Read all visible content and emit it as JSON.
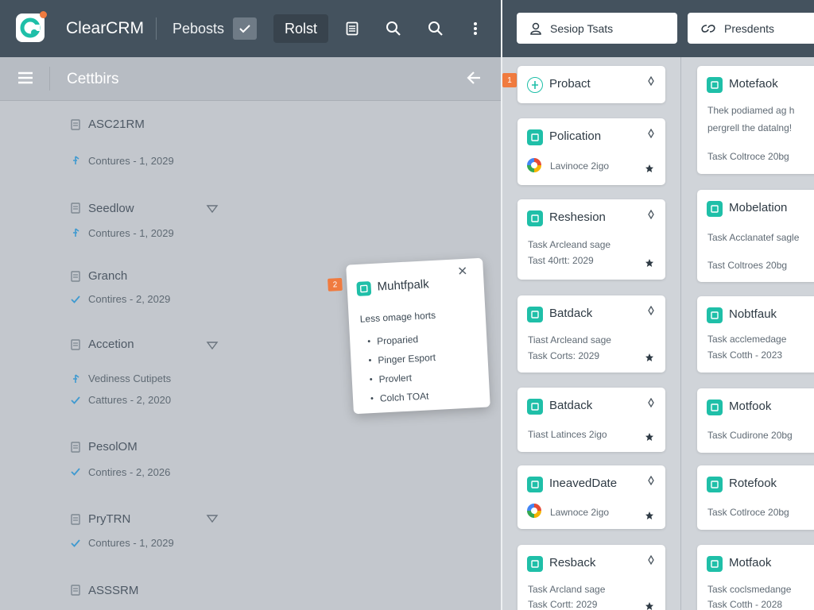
{
  "app": {
    "title": "ClearCRM"
  },
  "toolbar": {
    "reports_label": "Pebosts",
    "roster_label": "Rolst",
    "icons": [
      "check-icon",
      "document-icon",
      "search-icon",
      "search-icon",
      "more-vertical-icon"
    ]
  },
  "subheader": {
    "title": "Cettbirs"
  },
  "sidebar": {
    "items": [
      {
        "title": "ASC21RM",
        "sub": "Contures - 1, 2029",
        "sub_icon": "pin-icon",
        "dropdown": false
      },
      {
        "title": "Seedlow",
        "sub": "Contures - 1, 2029",
        "sub_icon": "pin-icon",
        "dropdown": true
      },
      {
        "title": "Granch",
        "sub": "Contires - 2, 2029",
        "sub_icon": "check-icon",
        "dropdown": false
      },
      {
        "title": "Accetion",
        "extra": "Vediness Cutipets",
        "sub": "Cattures - 2, 2020",
        "sub_icon": "check-icon",
        "dropdown": true
      },
      {
        "title": "PesolOM",
        "sub": "Contires - 2, 2026",
        "sub_icon": "check-icon",
        "dropdown": false
      },
      {
        "title": "PryTRN",
        "sub": "Contures - 1, 2029",
        "sub_icon": "check-icon",
        "dropdown": true
      },
      {
        "title": "ASSSRM",
        "sub": "",
        "sub_icon": "",
        "dropdown": false
      }
    ]
  },
  "popover": {
    "badge": "2",
    "title": "Muhtfpalk",
    "subtitle": "Less omage horts",
    "items": [
      "Proparied",
      "Pinger Esport",
      "Provlert",
      "Colch TOAt"
    ]
  },
  "right_header": {
    "session_tasks_label": "Sesiop Tsats",
    "presidents_label": "Presdents"
  },
  "board": {
    "badge": "1",
    "left_cards": [
      {
        "title": "Probact",
        "lines": []
      },
      {
        "title": "Polication",
        "avatar_text": "Lavinoce 2igo"
      },
      {
        "title": "Reshesion",
        "lines": [
          "Task Arcleand sage",
          "Tast 40rtt: 2029"
        ]
      },
      {
        "title": "Batdack",
        "lines": [
          "Tiast Arcleand sage",
          "Task Corts: 2029"
        ]
      },
      {
        "title": "Batdack",
        "lines": [
          "Tiast Latinces 2igo"
        ]
      },
      {
        "title": "IneavedDate",
        "avatar_text": "Lawnoce 2igo"
      },
      {
        "title": "Resback",
        "lines": [
          "Task Arcland sage",
          "Task Cortt: 2029"
        ]
      }
    ],
    "right_cards": [
      {
        "title": "Motefaok",
        "lines": [
          "Thek podiamed ag h",
          "pergrell the datalng!",
          "Task Coltroce 20bg"
        ]
      },
      {
        "title": "Mobelation",
        "lines": [
          "Task Acclanatef sagle",
          "Tast Coltroes 20bg"
        ]
      },
      {
        "title": "Nobtfauk",
        "lines": [
          "Task acclemedage",
          "Task Cotth - 2023"
        ]
      },
      {
        "title": "Motfook",
        "lines": [
          "Task Cudirone 20bg"
        ]
      },
      {
        "title": "Rotefook",
        "lines": [
          "Task Cotlroce 20bg"
        ]
      },
      {
        "title": "Motfaok",
        "lines": [
          "Task coclsmedange",
          "Task Cotth - 2028"
        ]
      }
    ]
  },
  "colors": {
    "header_bg": "#44525e",
    "accent": "#1fbfa8",
    "badge": "#f07b3f",
    "sidebar_bg": "#c3c7cd"
  }
}
